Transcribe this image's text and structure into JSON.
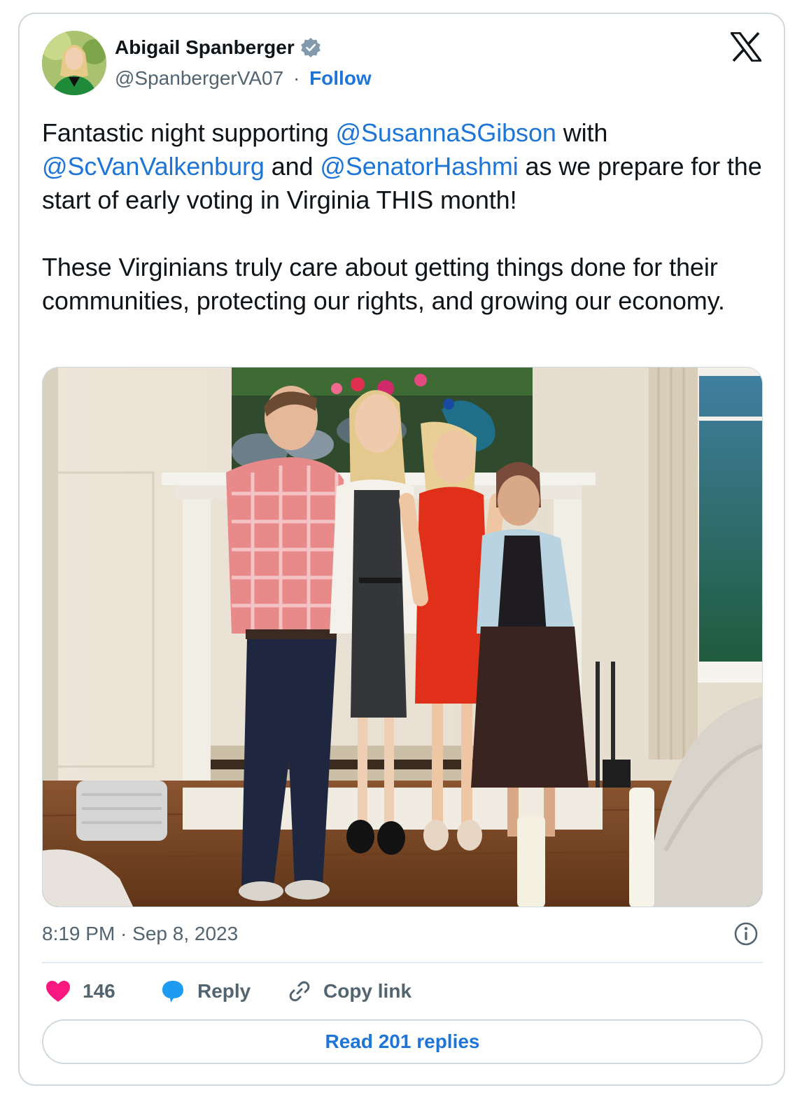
{
  "author": {
    "name": "Abigail Spanberger",
    "handle": "@SpanbergerVA07",
    "separator": "·",
    "follow_label": "Follow",
    "verified_icon": "verified-badge-icon"
  },
  "brand": {
    "logo": "x-logo-icon"
  },
  "tweet": {
    "p1_m1": "Fantastic night supporting ",
    "mention_1": "@SusannaSGibson",
    "p1_m2": " with ",
    "mention_2": "@ScVanValkenburg",
    "p1_m3": " and ",
    "mention_3": "@SenatorHashmi",
    "p1_m4": " as we prepare for the start of early voting in Virginia THIS month!",
    "p2": "These Virginians truly care about getting things done for their communities, protecting our rights, and growing our economy."
  },
  "meta": {
    "timestamp": "8:19 PM · Sep 8, 2023",
    "info_icon": "info-icon"
  },
  "actions": {
    "like_count": "146",
    "reply_label": "Reply",
    "copy_label": "Copy link"
  },
  "read_replies_label": "Read 201 replies",
  "colors": {
    "link": "#1d75d8",
    "text": "#0f1419",
    "muted": "#536471",
    "like": "#f91880",
    "reply": "#1d9bf0",
    "border": "#cfd9de"
  }
}
